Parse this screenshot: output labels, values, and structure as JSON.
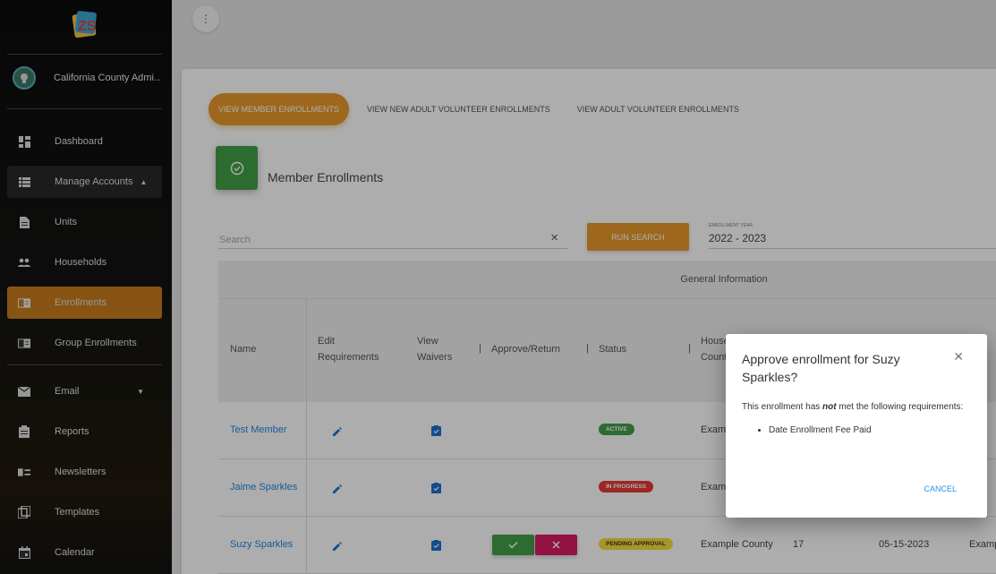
{
  "sidebar": {
    "user_name": "California County Admi…",
    "items": [
      {
        "label": "Dashboard",
        "icon": "dashboard-icon"
      },
      {
        "label": "Manage Accounts",
        "icon": "list-icon"
      },
      {
        "label": "Units",
        "icon": "document-icon"
      },
      {
        "label": "Households",
        "icon": "people-icon"
      },
      {
        "label": "Enrollments",
        "icon": "card-icon"
      },
      {
        "label": "Group Enrollments",
        "icon": "card-icon"
      },
      {
        "label": "Email",
        "icon": "mail-icon"
      },
      {
        "label": "Reports",
        "icon": "clipboard-icon"
      },
      {
        "label": "Newsletters",
        "icon": "newsletter-icon"
      },
      {
        "label": "Templates",
        "icon": "copy-icon"
      },
      {
        "label": "Calendar",
        "icon": "calendar-icon"
      }
    ]
  },
  "tabs": [
    {
      "label": "View Member Enrollments"
    },
    {
      "label": "View New Adult Volunteer Enrollments"
    },
    {
      "label": "View Adult Volunteer Enrollments"
    }
  ],
  "page": {
    "title": "Member Enrollments",
    "search_placeholder": "Search",
    "run_search": "Run Search",
    "year_label": "Enrollment Year",
    "year_value": "2022 - 2023"
  },
  "table": {
    "group_header": "General Information",
    "headers": {
      "name": "Name",
      "edit1": "Edit",
      "edit2": "Requirements",
      "view1": "View",
      "view2": "Waivers",
      "approve": "Approve/Return",
      "status": "Status",
      "house1": "House",
      "house2": "Count"
    },
    "rows": [
      {
        "name": "Test Member",
        "status": "Active",
        "county": "Examp"
      },
      {
        "name": "Jaime Sparkles",
        "status": "In Progress",
        "county": "Examp"
      },
      {
        "name": "Suzy Sparkles",
        "status": "Pending Approval",
        "county": "Example County",
        "age": "17",
        "date": "05-15-2023",
        "extra": "Examp"
      }
    ]
  },
  "dialog": {
    "title": "Approve enrollment for Suzy Sparkles?",
    "body_pre": "This enrollment has ",
    "body_em": "not",
    "body_post": " met the following requirements:",
    "requirement": "Date Enrollment Fee Paid",
    "cancel": "Cancel"
  },
  "colors": {
    "accent": "#e89a2c",
    "active_nav": "#c77d1c",
    "green": "#43a047",
    "link": "#1e88e5"
  }
}
